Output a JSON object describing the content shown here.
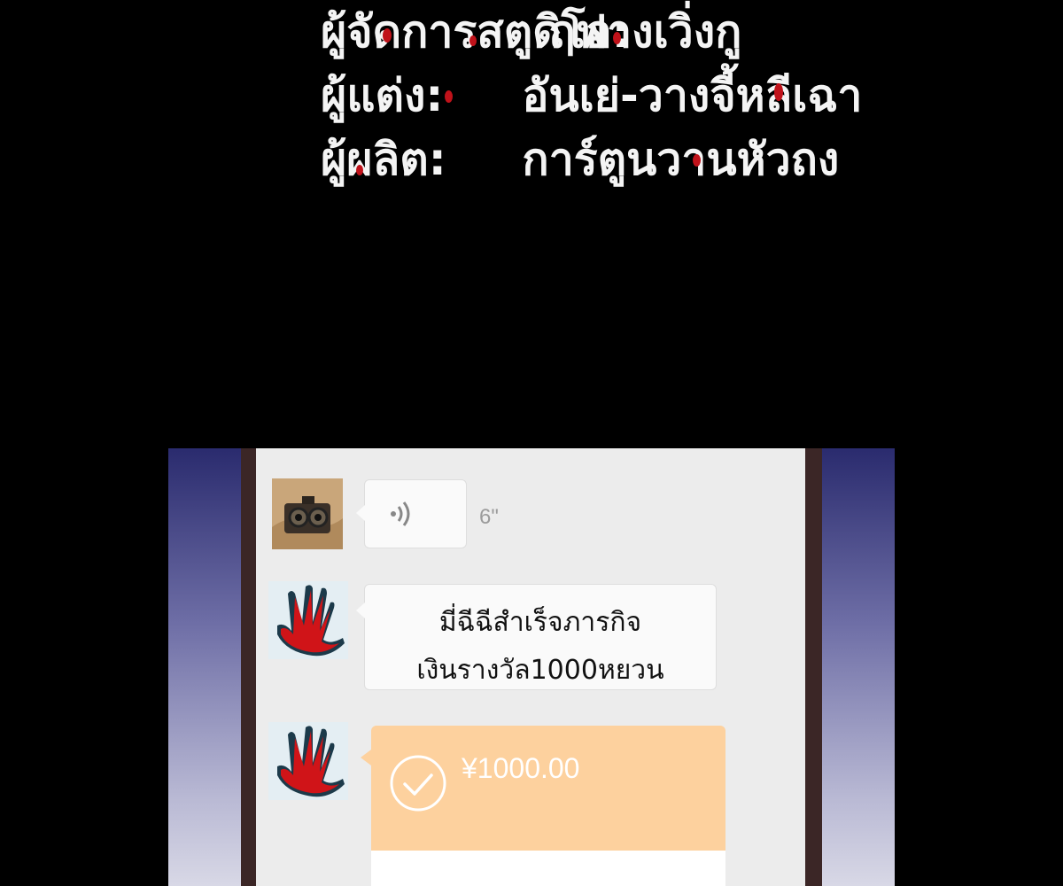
{
  "credits": [
    {
      "role": "ผู้จัดการสตูดิโอ:",
      "name": "ฤฟางเวิ่งกู"
    },
    {
      "role": "ผู้แต่ง:",
      "name": "อันเย่-วางจี้หลีเฉา"
    },
    {
      "role": "ผู้ผลิต:",
      "name": "การ์ตูนวานหัวถง"
    }
  ],
  "chat": {
    "voice_message": {
      "duration": "6\""
    },
    "text_message": {
      "line1": "มี่ฉีฉีสำเร็จภารกิจ",
      "line2": "เงินรางวัล1000หยวน"
    },
    "transfer": {
      "amount": "¥1000.00"
    }
  },
  "colors": {
    "transfer_bubble": "#fdd19e",
    "chat_background": "#ececec",
    "blood_accent": "#c0121a"
  },
  "icons": [
    "voice-wave-icon",
    "check-circle-icon",
    "camera-avatar",
    "bloody-hand-avatar"
  ]
}
